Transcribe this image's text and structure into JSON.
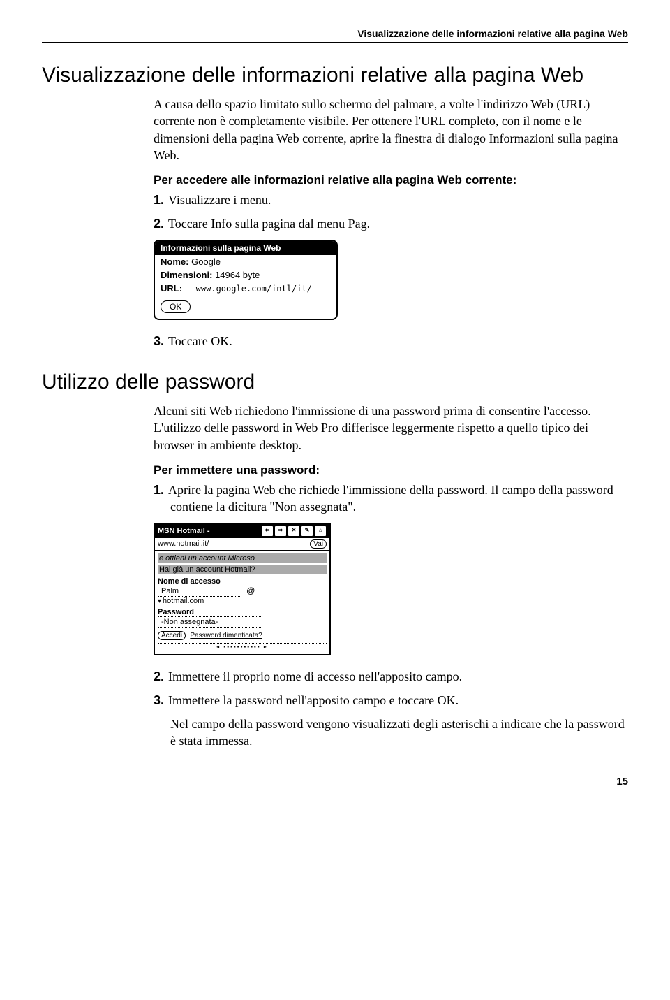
{
  "header": {
    "title": "Visualizzazione delle informazioni relative alla pagina Web"
  },
  "h1": "Visualizzazione delle informazioni relative alla pagina Web",
  "intro1": "A causa dello spazio limitato sullo schermo del palmare, a volte l'indirizzo Web (URL) corrente non è completamente visibile. Per ottenere l'URL completo, con il nome e le dimensioni della pagina Web corrente, aprire la finestra di dialogo Informazioni sulla pagina Web.",
  "sub1": "Per accedere alle informazioni relative alla pagina Web corrente:",
  "steps1": {
    "n1": "1.",
    "t1": "Visualizzare i menu.",
    "n2": "2.",
    "t2": "Toccare Info sulla pagina dal menu Pag.",
    "n3": "3.",
    "t3": "Toccare OK."
  },
  "dialog": {
    "title": "Informazioni sulla pagina Web",
    "nome_label": "Nome:",
    "nome_value": "Google",
    "dim_label": "Dimensioni:",
    "dim_value": "14964 byte",
    "url_label": "URL:",
    "url_value": "www.google.com/intl/it/",
    "ok": "OK"
  },
  "h2": "Utilizzo delle password",
  "intro2": "Alcuni siti Web richiedono l'immissione di una password prima di consentire l'accesso. L'utilizzo delle password in Web Pro differisce leggermente rispetto a quello tipico dei browser in ambiente desktop.",
  "sub2": "Per immettere una password:",
  "steps2": {
    "n1": "1.",
    "t1": "Aprire la pagina Web che richiede l'immissione della password. Il campo della password contiene la dicitura \"Non assegnata\".",
    "n2": "2.",
    "t2": "Immettere il proprio nome di accesso nell'apposito campo.",
    "n3": "3.",
    "t3": "Immettere la password nell'apposito campo e toccare OK."
  },
  "note2": "Nel campo della password vengono visualizzati degli asterischi a indicare che la password è stata immessa.",
  "browser": {
    "title": "MSN Hotmail -",
    "url": "www.hotmail.it/",
    "go": "Vai",
    "banner": "e ottieni un account Microso",
    "question": "Hai già un account Hotmail?",
    "username_label": "Nome di accesso",
    "username_value": "Palm",
    "at": "@",
    "domain": "hotmail.com",
    "password_label": "Password",
    "password_value": "-Non assegnata-",
    "login_btn": "Accedi",
    "forgot": "Password dimenticata?"
  },
  "page_number": "15"
}
